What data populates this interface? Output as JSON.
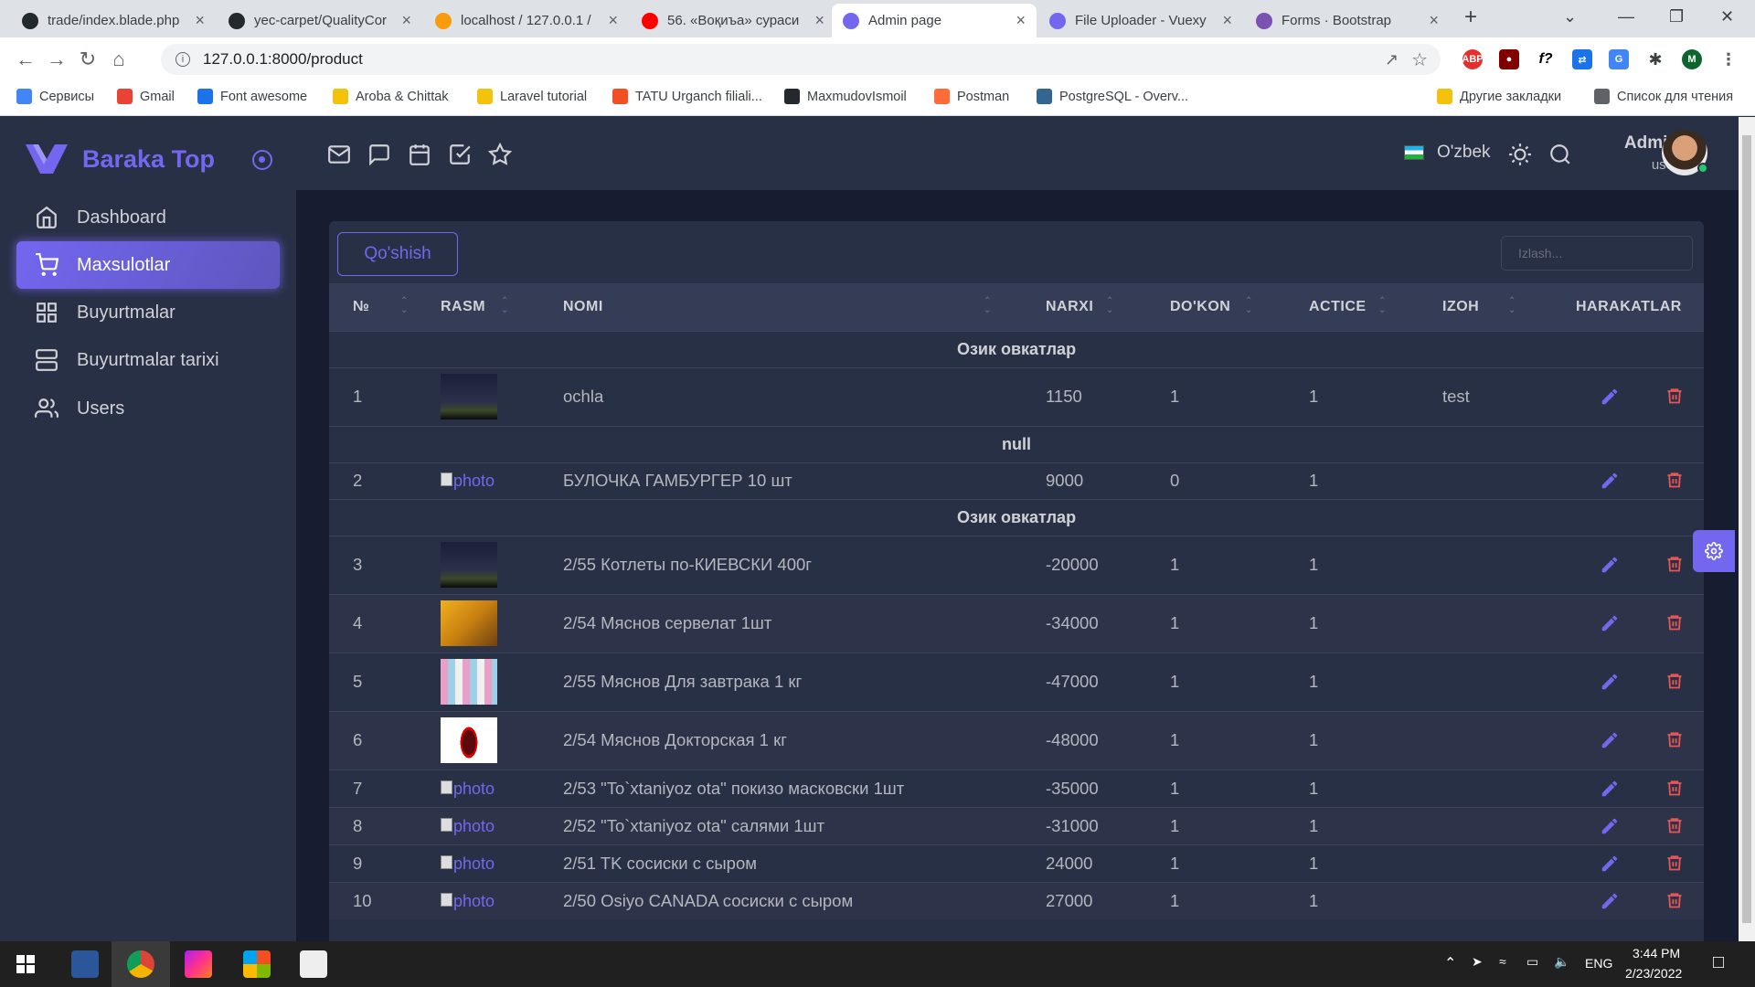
{
  "browser": {
    "tabs": [
      {
        "title": "trade/index.blade.php",
        "icon": "github-icon",
        "active": false
      },
      {
        "title": "yec-carpet/QualityCor",
        "icon": "github-icon",
        "active": false
      },
      {
        "title": "localhost / 127.0.0.1 /",
        "icon": "phpmyadmin-icon",
        "active": false
      },
      {
        "title": "56. «Воқиъа» сураси",
        "icon": "youtube-icon",
        "active": false
      },
      {
        "title": "Admin page",
        "icon": "vuexy-icon",
        "active": true
      },
      {
        "title": "File Uploader - Vuexy",
        "icon": "vuexy-icon",
        "active": false
      },
      {
        "title": "Forms · Bootstrap",
        "icon": "bootstrap-icon",
        "active": false
      }
    ],
    "url": "127.0.0.1:8000/product",
    "bookmarks": [
      "Сервисы",
      "Gmail",
      "Font awesome",
      "Aroba & Chittak",
      "Laravel tutorial",
      "TATU Urganch filiali...",
      "MaxmudovIsmoil",
      "Postman",
      "PostgreSQL - Overv..."
    ],
    "bookmarks_right": [
      "Другие закладки",
      "Список для чтения"
    ],
    "extensions": {
      "abp": "ABP",
      "fx": "f?"
    }
  },
  "app": {
    "brand": "Baraka Top",
    "menu": [
      {
        "label": "Dashboard",
        "icon": "home-icon",
        "active": false
      },
      {
        "label": "Maxsulotlar",
        "icon": "cart-icon",
        "active": true
      },
      {
        "label": "Buyurtmalar",
        "icon": "grid-icon",
        "active": false
      },
      {
        "label": "Buyurtmalar tarixi",
        "icon": "server-icon",
        "active": false
      },
      {
        "label": "Users",
        "icon": "users-icon",
        "active": false
      }
    ],
    "navbar": {
      "language": "O'zbek",
      "user_name": "Admin",
      "user_role": "user"
    },
    "add_button": "Qo'shish",
    "search_placeholder": "Izlash...",
    "table": {
      "headers": [
        "№",
        "RASM",
        "NOMI",
        "NARXI",
        "DO'KON",
        "ACTICE",
        "IZOH",
        "HARAKATLAR"
      ],
      "photo_alt": "photo",
      "groups": [
        {
          "title": "Озик овкатлар",
          "rows": [
            {
              "no": "1",
              "img": "night",
              "name": "ochla",
              "price": "1150",
              "shop": "1",
              "active": "1",
              "note": "test"
            }
          ]
        },
        {
          "title": "null",
          "rows": [
            {
              "no": "2",
              "img": "broken",
              "name": "БУЛОЧКА ГАМБУРГЕР 10 шт",
              "price": "9000",
              "shop": "0",
              "active": "1",
              "note": ""
            }
          ]
        },
        {
          "title": "Озик овкатлар",
          "rows": [
            {
              "no": "3",
              "img": "night",
              "name": "2/55 Котлеты по-КИЕВСКИ 400г",
              "price": "-20000",
              "shop": "1",
              "active": "1",
              "note": ""
            },
            {
              "no": "4",
              "img": "autumn",
              "name": "2/54 Мяснов сервелат 1шт",
              "price": "-34000",
              "shop": "1",
              "active": "1",
              "note": ""
            },
            {
              "no": "5",
              "img": "pattern",
              "name": "2/55 Мяснов Для завтрака 1 кг",
              "price": "-47000",
              "shop": "1",
              "active": "1",
              "note": ""
            },
            {
              "no": "6",
              "img": "cola",
              "name": "2/54 Мяснов Докторская 1 кг",
              "price": "-48000",
              "shop": "1",
              "active": "1",
              "note": ""
            },
            {
              "no": "7",
              "img": "broken",
              "name": "2/53 \"To`xtaniyoz ota\" покизо масковски 1шт",
              "price": "-35000",
              "shop": "1",
              "active": "1",
              "note": ""
            },
            {
              "no": "8",
              "img": "broken",
              "name": "2/52 \"To`xtaniyoz ota\" салями 1шт",
              "price": "-31000",
              "shop": "1",
              "active": "1",
              "note": ""
            },
            {
              "no": "9",
              "img": "broken",
              "name": "2/51 TK сосиски с сыром",
              "price": "24000",
              "shop": "1",
              "active": "1",
              "note": ""
            },
            {
              "no": "10",
              "img": "broken",
              "name": "2/50 Osiyo CANADA сосиски с сыром",
              "price": "27000",
              "shop": "1",
              "active": "1",
              "note": ""
            }
          ]
        }
      ]
    }
  },
  "taskbar": {
    "lang": "ENG",
    "time": "3:44 PM",
    "date": "2/23/2022"
  },
  "colors": {
    "accent": "#7367f0",
    "danger": "#ea5455",
    "bg": "#161d31",
    "card": "#283046"
  }
}
